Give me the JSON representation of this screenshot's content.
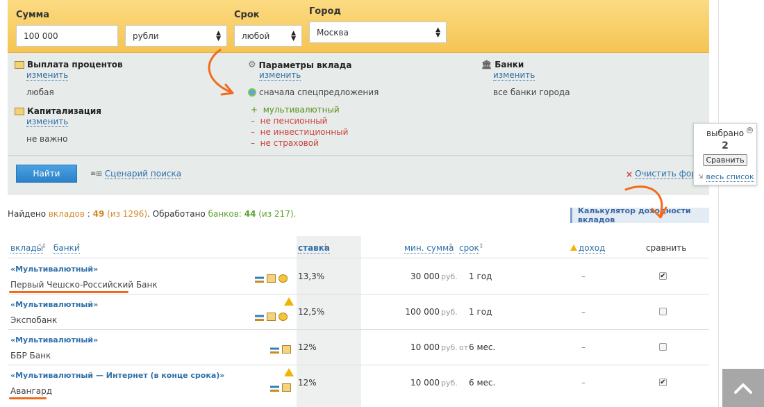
{
  "form": {
    "sum_label": "Сумма",
    "sum_value": "100 000",
    "currency_value": "рубли",
    "term_label": "Срок",
    "term_value": "любой",
    "city_label": "Город",
    "city_value": "Москва"
  },
  "params": {
    "payout_title": "Выплата процентов",
    "payout_change": "изменить",
    "payout_value": "любая",
    "cap_title": "Капитализация",
    "cap_change": "изменить",
    "cap_value": "не важно",
    "deposit_title": "Параметры вклада",
    "deposit_change": "изменить",
    "special_offers": "сначала спецпредложения",
    "options": [
      {
        "sign": "+",
        "text": "мультивалютный"
      },
      {
        "sign": "–",
        "text": "не пенсионный"
      },
      {
        "sign": "–",
        "text": "не инвестиционный"
      },
      {
        "sign": "–",
        "text": "не страховой"
      }
    ],
    "banks_title": "Банки",
    "banks_change": "изменить",
    "banks_value": "все банки города"
  },
  "actions": {
    "find_button": "Найти",
    "scenario_link": "Сценарий поиска",
    "clear_link": "Очистить форму",
    "all_list_link": "весь список"
  },
  "compare_popup": {
    "label": "выбрано",
    "count": "2",
    "button": "Сравнить"
  },
  "summary": {
    "prefix": "Найдено ",
    "deposits_word": "вкладов",
    "deposits_count": "49",
    "deposits_total": "(из 1296)",
    "middle": ". Обработано ",
    "banks_word": "банков:",
    "banks_count": "44",
    "banks_total": "(из 217).",
    "calculator": "Калькулятор доходности вкладов"
  },
  "table": {
    "col_deposits": "вклады",
    "col_banks": "банки",
    "col_rate": "ставка",
    "col_min_sum": "мин. сумма",
    "col_term": "срок",
    "col_income": "доход",
    "col_compare": "сравнить",
    "rows": [
      {
        "name": "«Мультивалютный»",
        "bank": "Первый Чешско-Российский Банк",
        "rate": "13,3%",
        "sum": "30 000",
        "currency": "руб.",
        "from": "",
        "term": "1 год",
        "income": "–",
        "checked": true
      },
      {
        "name": "«Мультивалютный»",
        "bank": "Экспобанк",
        "rate": "12,5%",
        "sum": "100 000",
        "currency": "руб.",
        "from": "",
        "term": "1 год",
        "income": "–",
        "checked": false
      },
      {
        "name": "«Мультивалютный»",
        "bank": "ББР Банк",
        "rate": "12%",
        "sum": "10 000",
        "currency": "руб.",
        "from": "от",
        "term": "6 мес.",
        "income": "–",
        "checked": false
      },
      {
        "name": "«Мультивалютный — Интернет (в конце срока)»",
        "bank": "Авангард",
        "rate": "12%",
        "sum": "10 000",
        "currency": "руб.",
        "from": "",
        "term": "6 мес.",
        "income": "–",
        "checked": true
      }
    ]
  },
  "icons": {
    "close": "⊗",
    "checkmark": "✔",
    "sort": "⇕",
    "remove": "×"
  }
}
